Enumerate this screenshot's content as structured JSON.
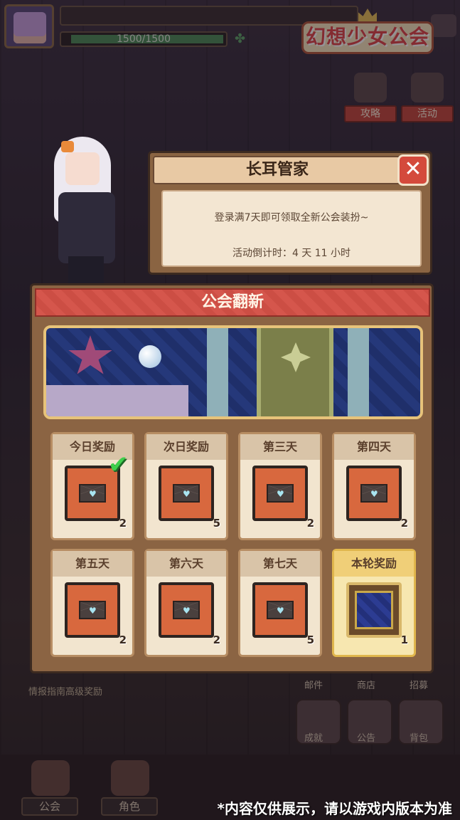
{
  "header": {
    "hp_text": "1500/1500",
    "logo_text": "幻想少女公会"
  },
  "side_buttons": [
    {
      "label": "攻略",
      "icon": "guide-icon"
    },
    {
      "label": "活动",
      "icon": "event-icon"
    }
  ],
  "dialog": {
    "title": "长耳管家",
    "message": "登录满7天即可领取全新公会装扮~",
    "countdown": "活动倒计时：4 天 11 小时",
    "close_glyph": "✕"
  },
  "panel": {
    "title": "公会翻新",
    "rewards": [
      {
        "day": "今日奖励",
        "count": "2",
        "claimed": true,
        "item": "envelope"
      },
      {
        "day": "次日奖励",
        "count": "5",
        "claimed": false,
        "item": "envelope"
      },
      {
        "day": "第三天",
        "count": "2",
        "claimed": false,
        "item": "envelope"
      },
      {
        "day": "第四天",
        "count": "2",
        "claimed": false,
        "item": "envelope"
      },
      {
        "day": "第五天",
        "count": "2",
        "claimed": false,
        "item": "envelope"
      },
      {
        "day": "第六天",
        "count": "2",
        "claimed": false,
        "item": "envelope"
      },
      {
        "day": "第七天",
        "count": "5",
        "claimed": false,
        "item": "envelope"
      },
      {
        "day": "本轮奖励",
        "count": "1",
        "claimed": false,
        "item": "gem-frame"
      }
    ]
  },
  "background_labels": {
    "intel_text": "情报指南高级奖励",
    "mail": "邮件",
    "shop": "商店",
    "recruit": "招募",
    "achievement": "成就",
    "notice": "公告",
    "bag": "背包"
  },
  "bottom_nav": [
    {
      "label": "公会"
    },
    {
      "label": "角色"
    }
  ],
  "disclaimer": "*内容仅供展示，请以游戏内版本为准",
  "colors": {
    "accent_red": "#d5564c",
    "panel_brown": "#8b6443",
    "card_cream": "#f2e5cf",
    "check_green": "#3fcf4c"
  }
}
